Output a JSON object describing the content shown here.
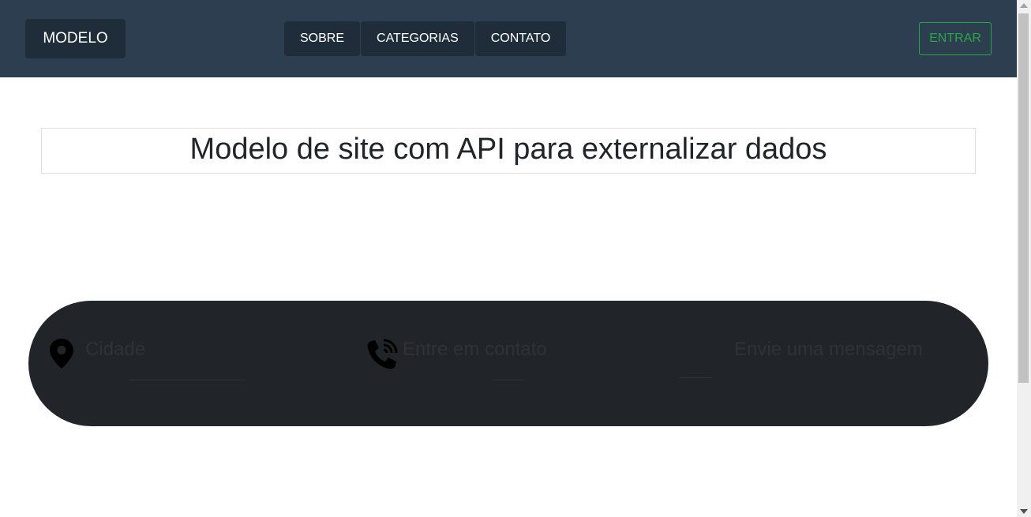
{
  "navbar": {
    "brand": "MODELO",
    "links": [
      "SOBRE",
      "CATEGORIAS",
      "CONTATO"
    ],
    "login_label": "ENTRAR",
    "colors": {
      "background": "#2c3e50",
      "login_accent": "#28a745"
    }
  },
  "main": {
    "headline": "Modelo de site com API para externalizar dados"
  },
  "contact_band": {
    "items": [
      {
        "icon": "location-pin-icon",
        "label": "Cidade"
      },
      {
        "icon": "phone-call-icon",
        "label": "Entre em contato"
      },
      {
        "icon": "",
        "label": "Envie uma mensagem"
      }
    ],
    "colors": {
      "background": "#212529"
    }
  }
}
